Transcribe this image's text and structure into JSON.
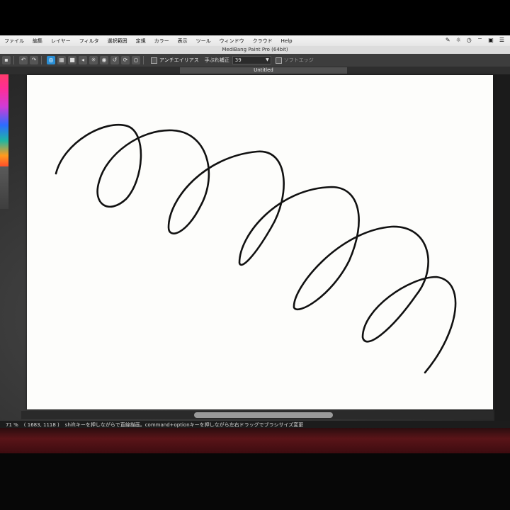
{
  "menu": {
    "items": [
      "ファイル",
      "編集",
      "レイヤー",
      "フィルタ",
      "選択範囲",
      "定規",
      "カラー",
      "表示",
      "ツール",
      "ウィンドウ",
      "クラウド",
      "Help"
    ]
  },
  "window": {
    "title": "MediBang Paint Pro (64bit)"
  },
  "toolbar": {
    "antialias_label": "アンチエイリアス",
    "stabilizer_label": "手ぶれ補正",
    "stabilizer_value": "39",
    "soft_edge_label": "ソフトエッジ"
  },
  "document": {
    "tab_title": "Untitled",
    "stroke_color": "#111111"
  },
  "status": {
    "zoom": "71 %",
    "coords": "( 1683, 1118 )",
    "hint": "shiftキーを押しながらで直線描画。command+optionキーを押しながら左右ドラッグでブラシサイズ変更"
  },
  "colors": {
    "accent": "#2a8fd6",
    "toolbar_bg": "#3d3d3d",
    "canvas_bg": "#fdfdfb"
  }
}
